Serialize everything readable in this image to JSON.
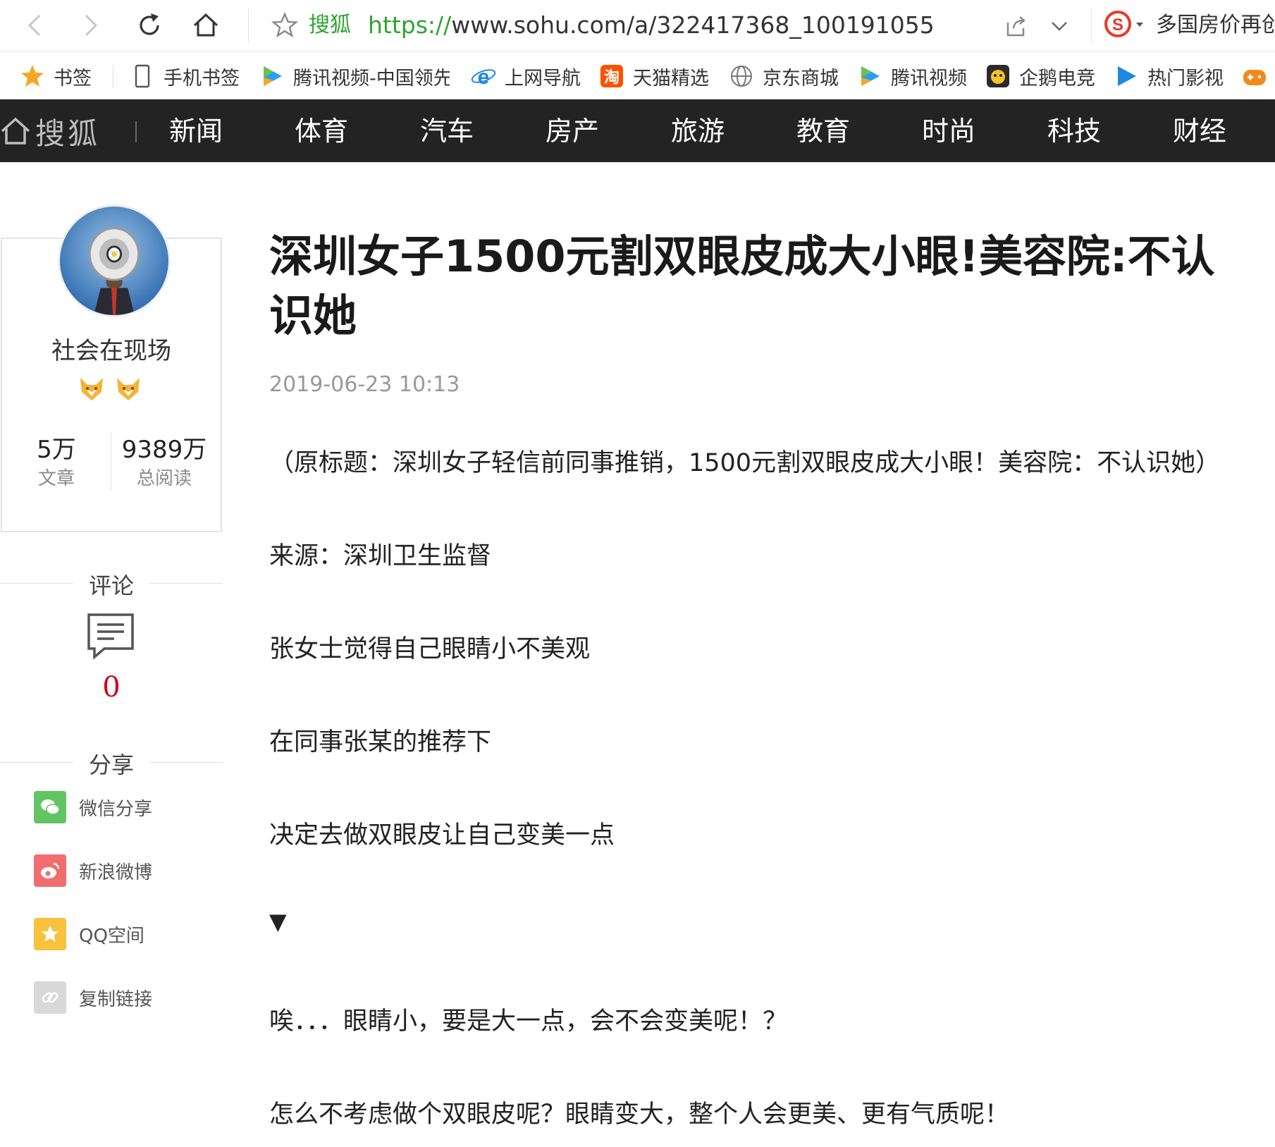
{
  "browser": {
    "site_name": "搜狐",
    "url_protocol": "https://",
    "url_rest": "www.sohu.com/a/322417368_100191055",
    "right_text": "多国房价再创"
  },
  "bookmarks": [
    {
      "label": "书签",
      "icon": "star-icon"
    },
    {
      "label": "手机书签",
      "icon": "phone-icon"
    },
    {
      "label": "腾讯视频-中国领先",
      "icon": "tencent-video-icon"
    },
    {
      "label": "上网导航",
      "icon": "ie-icon"
    },
    {
      "label": "天猫精选",
      "icon": "taobao-icon"
    },
    {
      "label": "京东商城",
      "icon": "globe-icon"
    },
    {
      "label": "腾讯视频",
      "icon": "tencent-video-icon"
    },
    {
      "label": "企鹅电竞",
      "icon": "penguin-esports-icon"
    },
    {
      "label": "热门影视",
      "icon": "play-icon"
    }
  ],
  "site_nav": {
    "logo": "搜狐",
    "items": [
      "新闻",
      "体育",
      "汽车",
      "房产",
      "旅游",
      "教育",
      "时尚",
      "科技",
      "财经"
    ]
  },
  "author": {
    "name": "社会在现场",
    "articles_count": "5万",
    "articles_label": "文章",
    "reads_count": "9389万",
    "reads_label": "总阅读"
  },
  "sidebar": {
    "comment_title": "评论",
    "comment_count": "0",
    "share_title": "分享",
    "share_items": [
      {
        "label": "微信分享",
        "icon": "wechat-icon",
        "color": "#62c462"
      },
      {
        "label": "新浪微博",
        "icon": "weibo-icon",
        "color": "#f26d6d"
      },
      {
        "label": "QQ空间",
        "icon": "qzone-icon",
        "color": "#f7c23e"
      },
      {
        "label": "复制链接",
        "icon": "link-icon",
        "color": "#d8d8d8"
      }
    ]
  },
  "article": {
    "title": "深圳女子1500元割双眼皮成大小眼!美容院:不认识她",
    "time": "2019-06-23 10:13",
    "paragraphs": [
      "（原标题：深圳女子轻信前同事推销，1500元割双眼皮成大小眼！美容院：不认识她）",
      "来源：深圳卫生监督",
      "张女士觉得自己眼睛小不美观",
      "在同事张某的推荐下",
      "决定去做双眼皮让自己变美一点",
      "▼",
      "唉．．．眼睛小，要是大一点，会不会变美呢！？",
      "怎么不考虑做个双眼皮呢？眼睛变大，整个人会更美、更有气质呢！"
    ]
  },
  "colors": {
    "nav_bg": "#232323",
    "site_green": "#2ea52e",
    "comment_red": "#d0021b"
  }
}
